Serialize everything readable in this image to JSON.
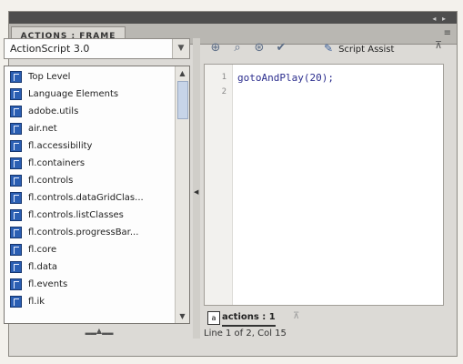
{
  "panel": {
    "tab_title": "ACTIONS : FRAME",
    "titlebar_dots": "◂ ▸",
    "tab_menu_glyph": "≡"
  },
  "left": {
    "language_select": "ActionScript 3.0",
    "tree_items": [
      "Top Level",
      "Language Elements",
      "adobe.utils",
      "air.net",
      "fl.accessibility",
      "fl.containers",
      "fl.controls",
      "fl.controls.dataGridClas...",
      "fl.controls.listClasses",
      "fl.controls.progressBar...",
      "fl.core",
      "fl.data",
      "fl.events",
      "fl.ik"
    ]
  },
  "toolbar": {
    "script_assist_label": "Script Assist",
    "icons": [
      "add-item-icon",
      "find-icon",
      "target-icon",
      "check-syntax-icon",
      "pin-icon"
    ]
  },
  "editor": {
    "line_numbers": [
      "1",
      "2"
    ],
    "code_lines": [
      "gotoAndPlay(20);"
    ]
  },
  "status": {
    "script_tab_label": "actions : 1",
    "line_info": "Line 1 of 2, Col 15"
  },
  "colors": {
    "code_text": "#2c2e8e",
    "book_icon": "#2b5fb3",
    "titlebar": "#4e4e4e"
  }
}
